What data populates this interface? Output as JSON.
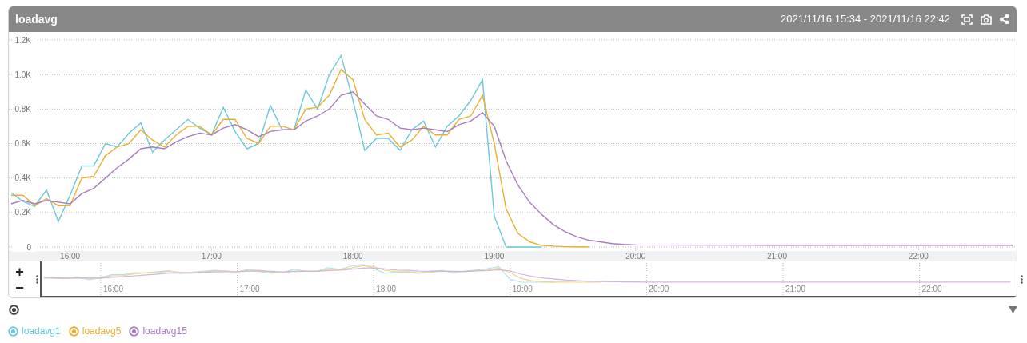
{
  "panel": {
    "title": "loadavg",
    "time_range": "2021/11/16 15:34 - 2021/11/16 22:42"
  },
  "chart_data": {
    "type": "line",
    "grid": true,
    "xlim": [
      934,
      1362
    ],
    "ylim": [
      0,
      1200
    ],
    "x": [
      935,
      940,
      945,
      950,
      955,
      960,
      965,
      970,
      975,
      980,
      985,
      990,
      995,
      1000,
      1005,
      1010,
      1015,
      1020,
      1025,
      1030,
      1035,
      1040,
      1045,
      1050,
      1055,
      1060,
      1065,
      1070,
      1075,
      1080,
      1085,
      1090,
      1095,
      1100,
      1105,
      1110,
      1115,
      1120,
      1125,
      1130,
      1135,
      1140,
      1145,
      1150,
      1155,
      1160,
      1165,
      1170,
      1175,
      1180,
      1185,
      1190,
      1195,
      1200,
      1230,
      1260,
      1290,
      1320,
      1350,
      1360
    ],
    "series": [
      {
        "name": "loadavg1",
        "color": "#6cc8d8",
        "values": [
          315,
          264,
          236,
          330,
          148,
          300,
          470,
          470,
          600,
          580,
          660,
          720,
          550,
          620,
          680,
          740,
          690,
          650,
          810,
          670,
          570,
          600,
          820,
          680,
          680,
          910,
          800,
          1000,
          1110,
          850,
          560,
          630,
          630,
          560,
          680,
          730,
          580,
          700,
          760,
          850,
          970,
          180,
          0,
          0,
          0,
          0,
          null,
          null,
          null,
          null,
          null,
          null,
          null,
          null,
          null,
          null,
          null,
          null,
          null,
          null
        ]
      },
      {
        "name": "loadavg5",
        "color": "#e8b030",
        "values": [
          300,
          300,
          240,
          280,
          240,
          240,
          400,
          410,
          530,
          580,
          600,
          680,
          620,
          580,
          650,
          700,
          700,
          650,
          740,
          740,
          630,
          600,
          700,
          700,
          680,
          800,
          810,
          880,
          1030,
          970,
          740,
          650,
          660,
          580,
          620,
          700,
          650,
          650,
          740,
          760,
          880,
          600,
          220,
          80,
          30,
          10,
          5,
          2,
          1,
          0,
          null,
          null,
          null,
          null,
          null,
          null,
          null,
          null,
          null,
          null
        ]
      },
      {
        "name": "loadavg15",
        "color": "#a87cc0",
        "values": [
          250,
          270,
          250,
          270,
          260,
          250,
          310,
          340,
          400,
          460,
          510,
          570,
          580,
          570,
          610,
          640,
          660,
          650,
          690,
          710,
          680,
          640,
          670,
          680,
          680,
          730,
          760,
          800,
          880,
          900,
          830,
          760,
          740,
          690,
          680,
          690,
          680,
          670,
          710,
          730,
          780,
          700,
          500,
          360,
          260,
          190,
          130,
          90,
          60,
          40,
          30,
          20,
          15,
          12,
          11,
          10,
          10,
          10,
          10,
          10
        ]
      }
    ],
    "xticks": [
      {
        "value": 960,
        "label": "16:00"
      },
      {
        "value": 1020,
        "label": "17:00"
      },
      {
        "value": 1080,
        "label": "18:00"
      },
      {
        "value": 1140,
        "label": "19:00"
      },
      {
        "value": 1200,
        "label": "20:00"
      },
      {
        "value": 1260,
        "label": "21:00"
      },
      {
        "value": 1320,
        "label": "22:00"
      }
    ],
    "yticks": [
      {
        "value": 0,
        "label": "0"
      },
      {
        "value": 200,
        "label": "0.2K"
      },
      {
        "value": 400,
        "label": "0.4K"
      },
      {
        "value": 600,
        "label": "0.6K"
      },
      {
        "value": 800,
        "label": "0.8K"
      },
      {
        "value": 1000,
        "label": "1.0K"
      },
      {
        "value": 1200,
        "label": "1.2K"
      }
    ]
  },
  "navigator": {
    "zoom_in": "+",
    "zoom_out": "−",
    "ticks": [
      "16:00",
      "17:00",
      "18:00",
      "19:00",
      "20:00",
      "21:00",
      "22:00"
    ]
  }
}
